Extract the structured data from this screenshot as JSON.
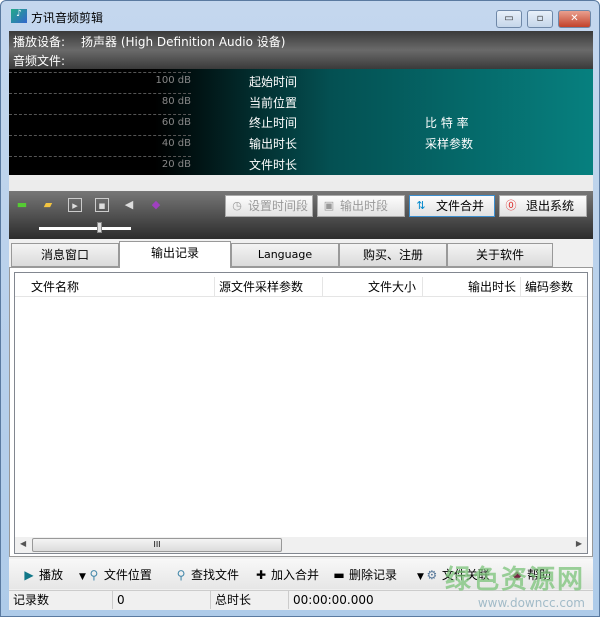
{
  "window": {
    "title": "方讯音频剪辑",
    "minimize": "▭",
    "maximize": "▫",
    "close": "✕"
  },
  "info": {
    "device_label": "播放设备:",
    "device_value": "扬声器 (High Definition Audio 设备)",
    "file_label": "音频文件:"
  },
  "meter": {
    "levels": [
      "100 dB",
      "80 dB",
      "60 dB",
      "40 dB",
      "20 dB"
    ],
    "labels": [
      "起始时间",
      "当前位置",
      "终止时间",
      "输出时长",
      "文件时长"
    ],
    "right_labels": [
      "比 特 率",
      "采样参数"
    ]
  },
  "toolbar": {
    "icons": [
      "sound-card-icon",
      "folder-open-icon",
      "play-icon",
      "stop-icon",
      "volume-icon",
      "book-icon"
    ],
    "buttons": [
      {
        "label": "设置时间段",
        "enabled": false
      },
      {
        "label": "输出时段",
        "enabled": false
      },
      {
        "label": "文件合并",
        "enabled": true
      },
      {
        "label": "退出系统",
        "enabled": true
      }
    ],
    "volume": 0.66
  },
  "tabs": [
    {
      "label": "消息窗口"
    },
    {
      "label": "输出记录",
      "active": true
    },
    {
      "label": "Language"
    },
    {
      "label": "购买、注册"
    },
    {
      "label": "关于软件"
    }
  ],
  "list": {
    "columns": [
      "文件名称",
      "源文件采样参数",
      "文件大小",
      "输出时长",
      "编码参数"
    ],
    "rows": [],
    "scroll_thumb": "III"
  },
  "actions": [
    "播放",
    "文件位置",
    "查找文件",
    "加入合并",
    "删除记录",
    "文件关联",
    "帮助"
  ],
  "status": {
    "count_label": "记录数",
    "count": "0",
    "duration_label": "总时长",
    "duration": "00:00:00.000"
  },
  "watermark": {
    "text": "绿色资源网",
    "url": "www.downcc.com"
  }
}
